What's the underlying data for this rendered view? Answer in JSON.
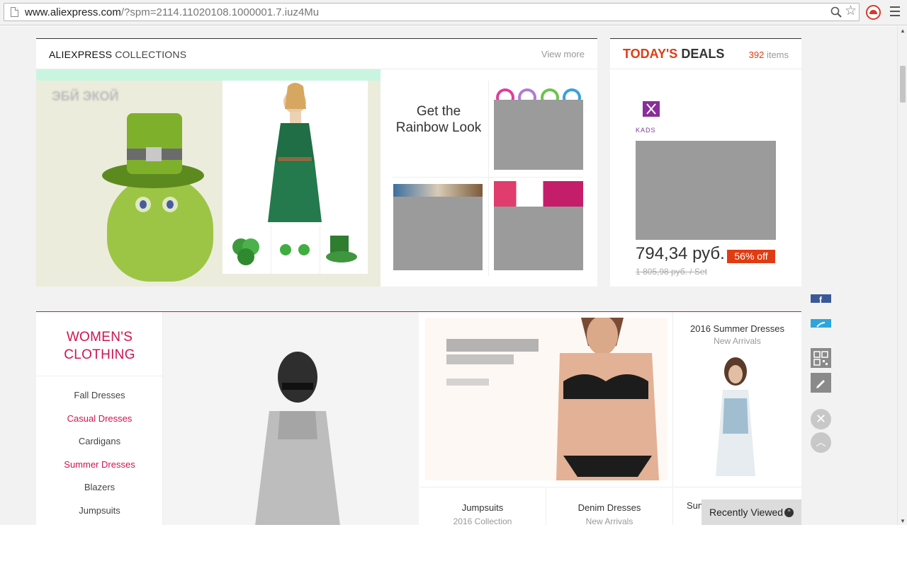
{
  "browser": {
    "url_host": "www.aliexpress.com",
    "url_rest": "/?spm=2114.11020108.1000001.7.iuz4Mu"
  },
  "collections": {
    "title_bold": "ALIEXPRESS",
    "title_rest": " COLLECTIONS",
    "view_more": "View more",
    "promo_caption": "ЭБЙ ЭКОЙ",
    "rainbow_title": "Get the Rainbow Look"
  },
  "deals": {
    "title_highlight": "TODAY'S",
    "title_rest": " DEALS",
    "count": "392",
    "count_suffix": " items",
    "brand": "KADS",
    "price": "794,34 руб.",
    "discount": "56% off",
    "old_price": "1 805,98 руб. / Set"
  },
  "womens": {
    "title": "WOMEN'S CLOTHING",
    "links": [
      {
        "label": "Fall Dresses",
        "hot": false
      },
      {
        "label": "Casual Dresses",
        "hot": true
      },
      {
        "label": "Cardigans",
        "hot": false
      },
      {
        "label": "Summer Dresses",
        "hot": true
      },
      {
        "label": "Blazers",
        "hot": false
      },
      {
        "label": "Jumpsuits",
        "hot": false
      }
    ],
    "tiles": [
      {
        "title": "Jumpsuits",
        "sub": "2016 Collection"
      },
      {
        "title": "Denim Dresses",
        "sub": "New Arrivals"
      }
    ],
    "summer": {
      "title": "2016 Summer Dresses",
      "sub": "New Arrivals"
    },
    "summer_partial": "Sun"
  },
  "side_tools": {
    "fb_letter": "f",
    "close_glyph": "✕",
    "up_glyph": "︿"
  },
  "recently_viewed": {
    "label": "Recently Viewed",
    "icon_glyph": "^"
  },
  "colors": {
    "accent_red": "#e03c13",
    "clothing_pink": "#d0134f",
    "placeholder_gray": "#9b9b9b"
  }
}
